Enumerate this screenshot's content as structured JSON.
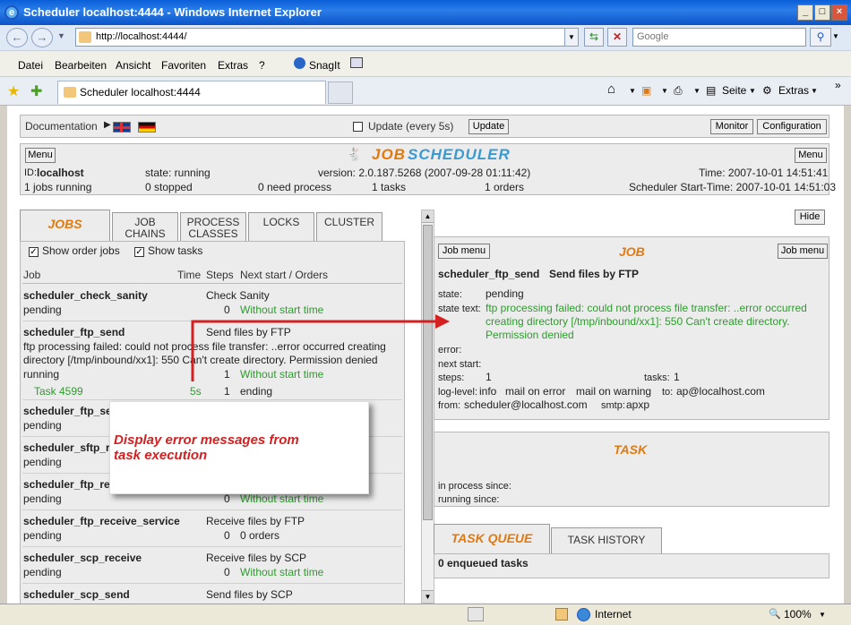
{
  "window": {
    "title": "Scheduler localhost:4444 - Windows Internet Explorer"
  },
  "browser": {
    "address": "http://localhost:4444/",
    "search_placeholder": "Google",
    "menu": [
      "Datei",
      "Bearbeiten",
      "Ansicht",
      "Favoriten",
      "Extras",
      "?"
    ],
    "snagit": "SnagIt",
    "tab_title": "Scheduler localhost:4444",
    "tools": {
      "seite": "Seite",
      "extras": "Extras"
    }
  },
  "topbar": {
    "documentation": "Documentation",
    "update_label": "Update (every 5s)",
    "update_button": "Update",
    "monitor_button": "Monitor",
    "configuration_button": "Configuration"
  },
  "header": {
    "menu_left": "Menu",
    "menu_right": "Menu",
    "logo_a": "JOB",
    "logo_b": "SCHEDULER",
    "id_label": "ID:",
    "id_value": "localhost",
    "state": "state: running",
    "version": "version: 2.0.187.5268 (2007-09-28 01:11:42)",
    "time": "Time: 2007-10-01 14:51:41",
    "jobs_running": "1 jobs running",
    "stopped": "0 stopped",
    "need_process": "0 need process",
    "tasks": "1 tasks",
    "orders": "1 orders",
    "start_time": "Scheduler Start-Time: 2007-10-01 14:51:03"
  },
  "left": {
    "tabs": [
      {
        "label": "JOBS"
      },
      {
        "label": "JOB\nCHAINS"
      },
      {
        "label": "PROCESS\nCLASSES"
      },
      {
        "label": "LOCKS"
      },
      {
        "label": "CLUSTER"
      }
    ],
    "show_order_jobs": "Show order jobs",
    "show_tasks": "Show tasks",
    "columns": {
      "job": "Job",
      "time": "Time",
      "steps": "Steps",
      "next": "Next start / Orders"
    },
    "jobs": [
      {
        "name": "scheduler_check_sanity",
        "title": "Check Sanity",
        "state": "pending",
        "steps": "0",
        "next": "Without start time"
      },
      {
        "name": "scheduler_ftp_send",
        "title": "Send files by FTP",
        "error1": "ftp processing failed: could not process file transfer: ..error occurred creating",
        "error2": "directory [/tmp/inbound/xx1]: 550 Can't create directory. Permission denied",
        "state": "running",
        "steps": "1",
        "next": "Without start time",
        "task": "Task 4599",
        "task_time": "5s",
        "task_steps": "1",
        "task_status": "ending"
      },
      {
        "name": "scheduler_ftp_se",
        "state": "pending"
      },
      {
        "name": "scheduler_sftp_r",
        "state": "pending"
      },
      {
        "name": "scheduler_ftp_re",
        "state": "pending",
        "steps": "0",
        "next": "Without start time"
      },
      {
        "name": "scheduler_ftp_receive_service",
        "title": "Receive files by FTP",
        "state": "pending",
        "steps": "0",
        "next": "0 orders"
      },
      {
        "name": "scheduler_scp_receive",
        "title": "Receive files by SCP",
        "state": "pending",
        "steps": "0",
        "next": "Without start time"
      },
      {
        "name": "scheduler_scp_send",
        "title": "Send files by SCP"
      }
    ]
  },
  "callout": {
    "line1": "Display error messages from",
    "line2": "task execution"
  },
  "right": {
    "hide_button": "Hide",
    "job_menu": "Job menu",
    "job_heading": "JOB",
    "job_name": "scheduler_ftp_send",
    "job_title": "Send files by FTP",
    "state_label": "state:",
    "state_value": "pending",
    "state_text_label": "state text:",
    "state_text": [
      "ftp processing failed: could not process file transfer: ..error occurred",
      "creating directory [/tmp/inbound/xx1]: 550 Can't create directory.",
      "Permission denied"
    ],
    "error_label": "error:",
    "next_start_label": "next start:",
    "steps_label": "steps:",
    "steps_value": "1",
    "tasks_label": "tasks:",
    "tasks_value": "1",
    "log_level_label": "log-level:",
    "log_level_value": "info",
    "mail_on_error": "mail on error",
    "mail_on_warning": "mail on warning",
    "to_label": "to:",
    "to_value": "ap@localhost.com",
    "from_label": "from:",
    "from_value": "scheduler@localhost.com",
    "smtp_label": "smtp:",
    "smtp_value": "apxp",
    "task_heading": "TASK",
    "in_process": "in process since:",
    "running_since": "running since:",
    "task_queue_tab": "TASK QUEUE",
    "task_history_tab": "TASK HISTORY",
    "enqueued": "0 enqueued tasks"
  },
  "statusbar": {
    "zone": "Internet",
    "zoom": "100%"
  },
  "colors": {
    "accent": "#e07a10",
    "green": "#2e9b2e",
    "arrow": "#d42020",
    "titlebar": "#0a5fd8"
  }
}
